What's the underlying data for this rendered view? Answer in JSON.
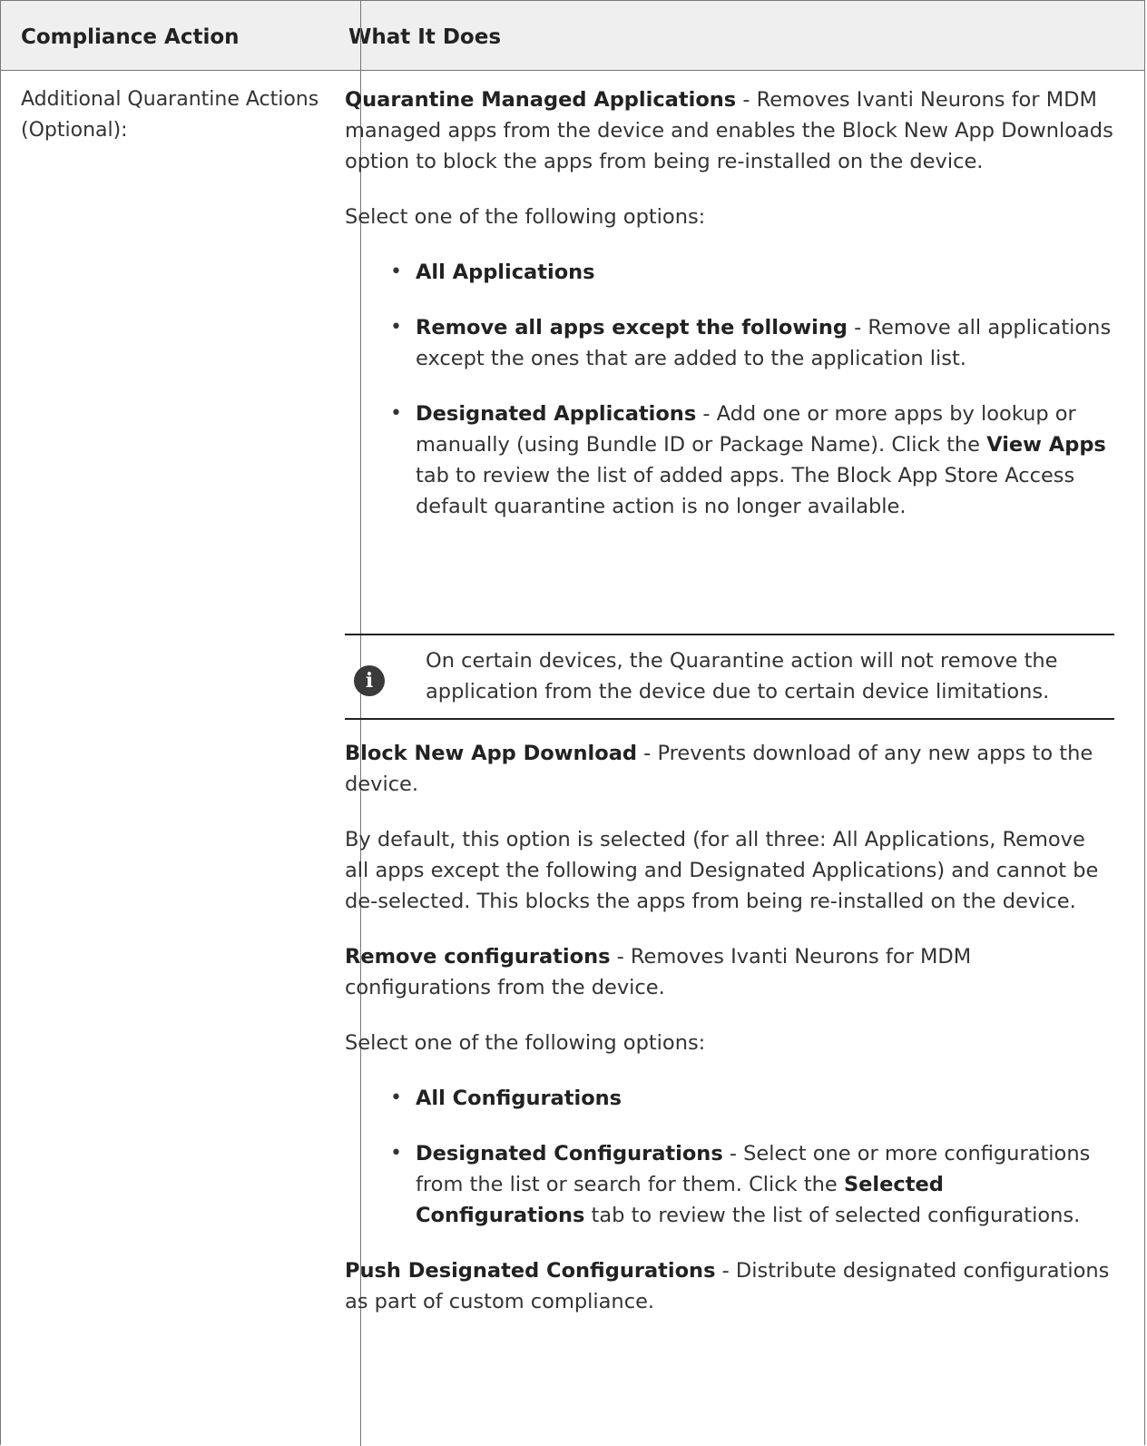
{
  "table": {
    "header": {
      "col1": "Compliance Action",
      "col2": "What It Does"
    },
    "row": {
      "action_label": "Additional Quarantine Actions (Optional):",
      "quarantine_apps": {
        "title": "Quarantine Managed Applications",
        "desc": " - Removes Ivanti Neurons for MDM managed apps from the device and enables the Block New App Downloads option to block the apps from being re-installed on the device."
      },
      "select_one_1": "Select one of the following options:",
      "app_options": [
        {
          "title": "All Applications",
          "desc": ""
        },
        {
          "title": "Remove all apps except the following",
          "desc": " - Remove all applications except the ones that are added to the application list."
        },
        {
          "title": "Designated Applications",
          "desc_a": " - Add one or more apps by lookup or manually (using Bundle ID or Package Name). Click the ",
          "bold_b": "View Apps",
          "desc_c": " tab to review the list of added apps. The Block App Store Access default quarantine action is no longer available."
        }
      ],
      "note": {
        "icon": "info-icon",
        "text": "On certain devices, the Quarantine action will not remove the application from the device due to certain device limitations."
      },
      "block_download": {
        "title": "Block New App Download",
        "desc": " - Prevents download of any new apps to the device."
      },
      "default_text": "By default, this option is selected (for all three: All Applications, Remove all apps except the following and Designated Applications) and cannot be de-selected. This blocks the apps from being re-installed on the device.",
      "remove_configs": {
        "title": "Remove configurations",
        "desc": " - Removes Ivanti Neurons for MDM configurations from the device."
      },
      "select_one_2": "Select one of the following options:",
      "config_options": [
        {
          "title": "All Configurations"
        },
        {
          "title": "Designated Configurations",
          "desc_a": " - Select one or more configurations from the list or search for them. Click the ",
          "bold_b": "Selected Configurations",
          "desc_c": " tab to review the list of selected configurations."
        }
      ],
      "push_configs": {
        "title": "Push Designated Configurations",
        "desc": " - Distribute designated configurations as part of custom compliance."
      }
    }
  }
}
